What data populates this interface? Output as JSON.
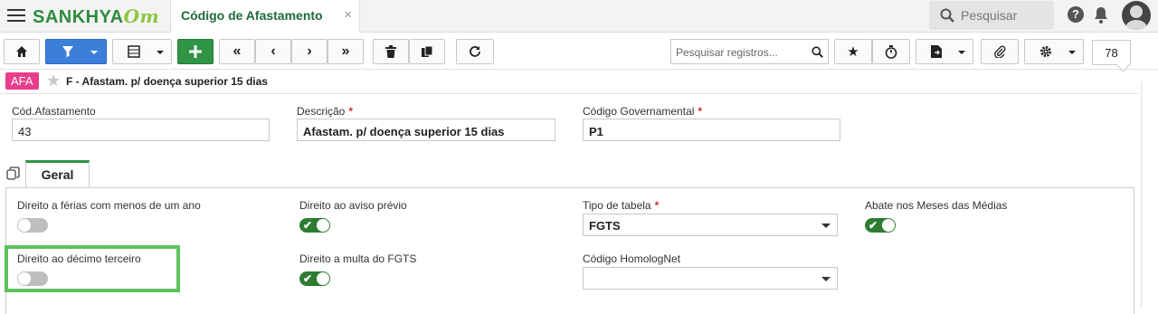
{
  "header": {
    "logo_main": "SANKHYA",
    "logo_script": "Om",
    "tab_title": "Código de Afastamento",
    "tab_close": "×",
    "search_placeholder": "Pesquisar",
    "help_glyph": "?"
  },
  "toolbar": {
    "search_records_placeholder": "Pesquisar registros...",
    "record_count": "78",
    "icons": [
      "home-icon",
      "filter-icon",
      "grid-icon",
      "add-icon",
      "first-icon",
      "previous-icon",
      "next-icon",
      "last-icon",
      "trash-icon",
      "copy-icon",
      "refresh-icon",
      "search-icon",
      "star-icon",
      "timer-icon",
      "export-icon",
      "attach-icon",
      "gear-icon"
    ]
  },
  "record": {
    "badge": "AFA",
    "title": "F - Afastam. p/ doença superior 15 dias"
  },
  "fields": {
    "cod_label": "Cód.Afastamento",
    "cod_value": "43",
    "desc_label": "Descrição",
    "desc_value": "Afastam. p/ doença superior 15 dias",
    "gov_label": "Código Governamental",
    "gov_value": "P1",
    "required_mark": "*"
  },
  "tabs": {
    "geral": "Geral"
  },
  "geral": {
    "ferias_label": "Direito a férias com menos de um ano",
    "ferias_on": false,
    "aviso_label": "Direito ao aviso prévio",
    "aviso_on": true,
    "tipo_label": "Tipo de tabela",
    "tipo_value": "FGTS",
    "abate_label": "Abate nos Meses das Médias",
    "abate_on": true,
    "decimo_label": "Direito ao décimo terceiro",
    "decimo_on": false,
    "multa_label": "Direito a multa do FGTS",
    "multa_on": true,
    "homolog_label": "Código HomologNet",
    "homolog_value": ""
  },
  "colors": {
    "brand_green": "#2e8b3e",
    "highlight": "#5dc35d",
    "badge": "#e83e8c",
    "toggle_on": "#2e7d32"
  }
}
